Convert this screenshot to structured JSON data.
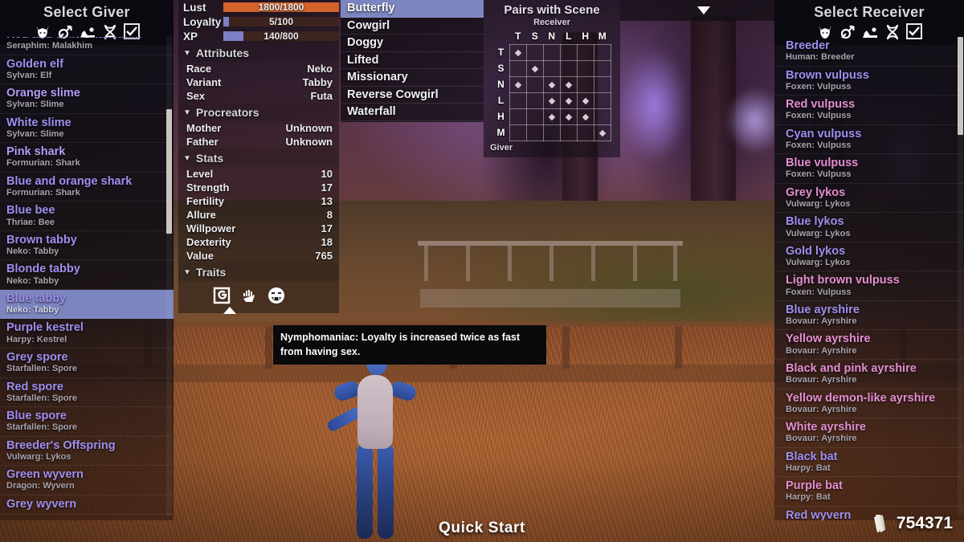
{
  "left_panel": {
    "title": "Select Giver",
    "filters": [
      {
        "name": "race-filter-icon",
        "icon": "fox-head-icon"
      },
      {
        "name": "sex-filter-icon",
        "icon": "gender-symbol-icon"
      },
      {
        "name": "pose-filter-icon",
        "icon": "pose-figure-icon"
      },
      {
        "name": "genetics-filter-icon",
        "icon": "dna-helix-icon"
      },
      {
        "name": "select-all-checkbox",
        "icon": "checkbox-checked-icon"
      }
    ],
    "entries": [
      {
        "name": "Red and white Malakhim",
        "sub": "Seraphim: Malakhim"
      },
      {
        "name": "Golden elf",
        "sub": "Sylvan: Elf"
      },
      {
        "name": "Orange slime",
        "sub": "Sylvan: Slime"
      },
      {
        "name": "White slime",
        "sub": "Sylvan: Slime"
      },
      {
        "name": "Pink shark",
        "sub": "Formurian: Shark"
      },
      {
        "name": "Blue and orange shark",
        "sub": "Formurian: Shark"
      },
      {
        "name": "Blue bee",
        "sub": "Thriae: Bee"
      },
      {
        "name": "Brown tabby",
        "sub": "Neko: Tabby"
      },
      {
        "name": "Blonde tabby",
        "sub": "Neko: Tabby"
      },
      {
        "name": "Blue tabby",
        "sub": "Neko: Tabby",
        "selected": true
      },
      {
        "name": "Purple kestrel",
        "sub": "Harpy: Kestrel"
      },
      {
        "name": "Grey spore",
        "sub": "Starfallen: Spore"
      },
      {
        "name": "Red spore",
        "sub": "Starfallen: Spore"
      },
      {
        "name": "Blue spore",
        "sub": "Starfallen: Spore"
      },
      {
        "name": "Breeder's Offspring",
        "sub": "Vulwarg: Lykos"
      },
      {
        "name": "Green wyvern",
        "sub": "Dragon: Wyvern"
      },
      {
        "name": "Grey wyvern",
        "sub": ""
      }
    ]
  },
  "info_panel": {
    "bars": [
      {
        "label": "Lust",
        "value": "1800/1800",
        "pct": 100,
        "color": "#d4622a"
      },
      {
        "label": "Loyalty",
        "value": "5/100",
        "pct": 5,
        "color": "#7b80c4"
      },
      {
        "label": "XP",
        "value": "140/800",
        "pct": 17.5,
        "color": "#7b80c4"
      }
    ],
    "sections": [
      {
        "title": "Attributes",
        "rows": [
          {
            "key": "Race",
            "value": "Neko"
          },
          {
            "key": "Variant",
            "value": "Tabby"
          },
          {
            "key": "Sex",
            "value": "Futa"
          }
        ]
      },
      {
        "title": "Procreators",
        "rows": [
          {
            "key": "Mother",
            "value": "Unknown"
          },
          {
            "key": "Father",
            "value": "Unknown"
          }
        ]
      },
      {
        "title": "Stats",
        "rows": [
          {
            "key": "Level",
            "value": "10"
          },
          {
            "key": "Strength",
            "value": "17"
          },
          {
            "key": "Fertility",
            "value": "13"
          },
          {
            "key": "Allure",
            "value": "8"
          },
          {
            "key": "Willpower",
            "value": "17"
          },
          {
            "key": "Dexterity",
            "value": "18"
          },
          {
            "key": "Value",
            "value": "765"
          }
        ]
      }
    ],
    "traits_title": "Traits",
    "traits": [
      {
        "name": "spiral-glyph-trait-icon"
      },
      {
        "name": "hand-trait-icon"
      },
      {
        "name": "smiling-face-trait-icon"
      }
    ],
    "tooltip": "Nymphomaniac: Loyalty is increased twice as fast from having sex."
  },
  "scene_list": {
    "items": [
      {
        "label": "Butterfly",
        "selected": true
      },
      {
        "label": "Cowgirl"
      },
      {
        "label": "Doggy"
      },
      {
        "label": "Lifted"
      },
      {
        "label": "Missionary"
      },
      {
        "label": "Reverse Cowgirl"
      },
      {
        "label": "Waterfall"
      }
    ]
  },
  "pairs": {
    "title": "Pairs with Scene",
    "receiver_label": "Receiver",
    "giver_label": "Giver",
    "columns": [
      "T",
      "S",
      "N",
      "L",
      "H",
      "M"
    ],
    "rows": [
      "T",
      "S",
      "N",
      "L",
      "H",
      "M"
    ],
    "matrix": [
      [
        1,
        0,
        0,
        0,
        0,
        0
      ],
      [
        0,
        1,
        0,
        0,
        0,
        0
      ],
      [
        1,
        0,
        1,
        1,
        0,
        0
      ],
      [
        0,
        0,
        1,
        1,
        1,
        0
      ],
      [
        0,
        0,
        1,
        1,
        1,
        0
      ],
      [
        0,
        0,
        0,
        0,
        0,
        1
      ]
    ]
  },
  "top_bar": {
    "dropdown_icon": "chevron-down-icon"
  },
  "right_panel": {
    "title": "Select Receiver",
    "filters": [
      {
        "name": "race-filter-icon",
        "icon": "fox-head-icon"
      },
      {
        "name": "sex-filter-icon",
        "icon": "gender-symbol-icon"
      },
      {
        "name": "pose-filter-icon",
        "icon": "pose-figure-icon"
      },
      {
        "name": "genetics-filter-icon",
        "icon": "dna-helix-icon"
      },
      {
        "name": "select-all-checkbox",
        "icon": "checkbox-checked-icon"
      }
    ],
    "entries": [
      {
        "name": "Breeder",
        "sub": "Human: Breeder",
        "color": "#9f8ff0"
      },
      {
        "name": "Brown vulpuss",
        "sub": "Foxen: Vulpuss",
        "color": "#9f8ff0"
      },
      {
        "name": "Red vulpuss",
        "sub": "Foxen: Vulpuss",
        "color": "#e48fd0"
      },
      {
        "name": "Cyan vulpuss",
        "sub": "Foxen: Vulpuss",
        "color": "#9f8ff0"
      },
      {
        "name": "Blue vulpuss",
        "sub": "Foxen: Vulpuss",
        "color": "#e48fd0"
      },
      {
        "name": "Grey lykos",
        "sub": "Vulwarg: Lykos",
        "color": "#e48fd0"
      },
      {
        "name": "Blue lykos",
        "sub": "Vulwarg: Lykos",
        "color": "#9f8ff0"
      },
      {
        "name": "Gold lykos",
        "sub": "Vulwarg: Lykos",
        "color": "#9f8ff0"
      },
      {
        "name": "Light brown vulpuss",
        "sub": "Foxen: Vulpuss",
        "color": "#e48fd0"
      },
      {
        "name": "Blue ayrshire",
        "sub": "Bovaur: Ayrshire",
        "color": "#9f8ff0"
      },
      {
        "name": "Yellow ayrshire",
        "sub": "Bovaur: Ayrshire",
        "color": "#e48fd0"
      },
      {
        "name": "Black and pink ayrshire",
        "sub": "Bovaur: Ayrshire",
        "color": "#e48fd0"
      },
      {
        "name": "Yellow demon-like ayrshire",
        "sub": "Bovaur: Ayrshire",
        "color": "#e48fd0"
      },
      {
        "name": "White ayrshire",
        "sub": "Bovaur: Ayrshire",
        "color": "#e48fd0"
      },
      {
        "name": "Black bat",
        "sub": "Harpy: Bat",
        "color": "#9f8ff0"
      },
      {
        "name": "Purple bat",
        "sub": "Harpy: Bat",
        "color": "#e48fd0"
      },
      {
        "name": "Red wyvern",
        "sub": "",
        "color": "#9f8ff0"
      }
    ]
  },
  "footer": {
    "quick_start": "Quick Start",
    "currency_amount": "754371",
    "currency_icon": "bone-currency-icon"
  }
}
